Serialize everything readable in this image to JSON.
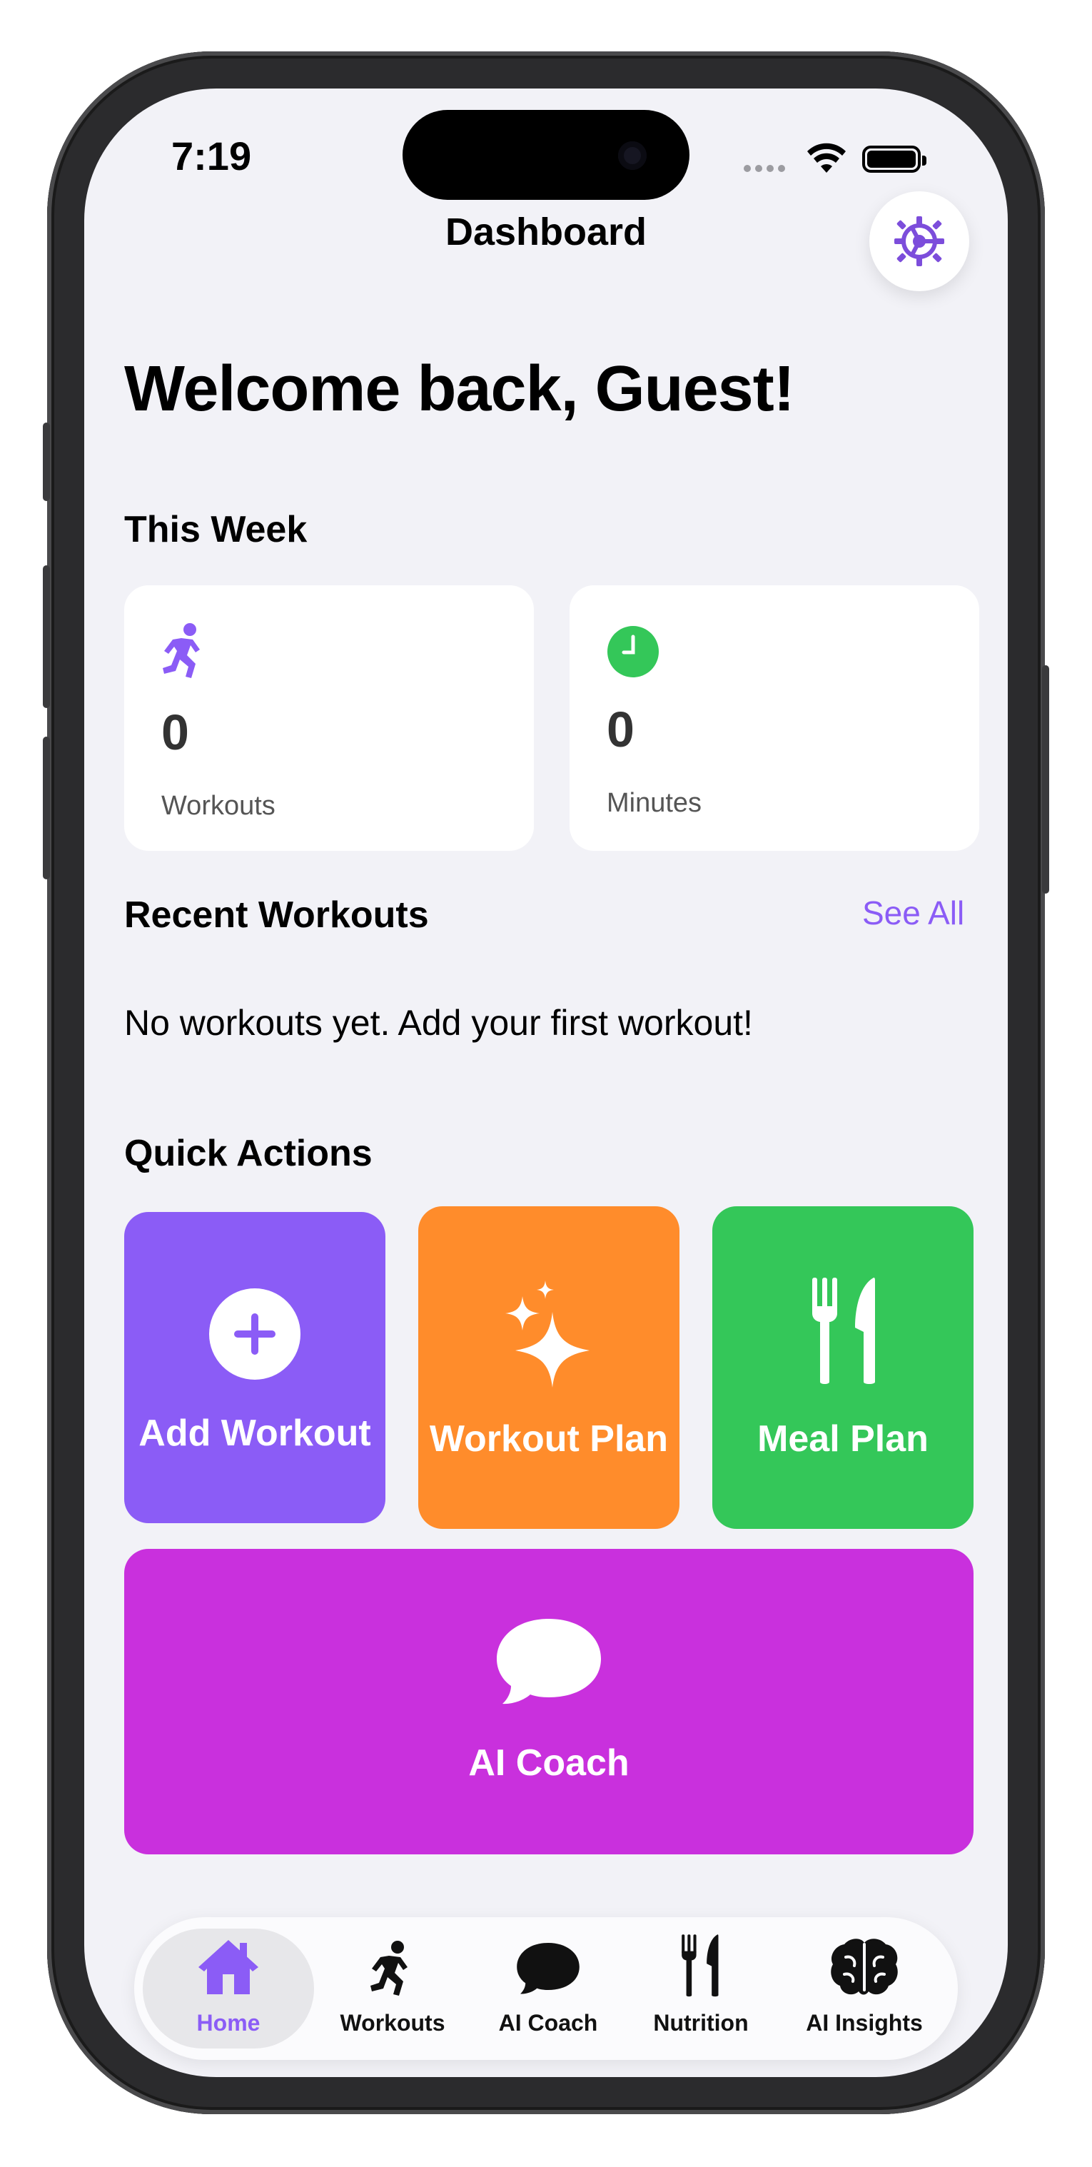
{
  "status_bar": {
    "time": "7:19"
  },
  "nav": {
    "title": "Dashboard"
  },
  "welcome": "Welcome back, Guest!",
  "this_week": {
    "heading": "This Week",
    "stats": [
      {
        "icon": "running-figure-icon",
        "value": "0",
        "label": "Workouts",
        "color": "#8b5cf6"
      },
      {
        "icon": "clock-icon",
        "value": "0",
        "label": "Minutes",
        "color": "#34c759"
      }
    ]
  },
  "recent": {
    "heading": "Recent Workouts",
    "see_all": "See All",
    "empty_text": "No workouts yet. Add your first workout!"
  },
  "quick_actions": {
    "heading": "Quick Actions",
    "items": [
      {
        "label": "Add Workout",
        "icon": "plus-circle-icon",
        "color": "#8b5cf6"
      },
      {
        "label": "Workout Plan",
        "icon": "sparkles-icon",
        "color": "#ff8c2b"
      },
      {
        "label": "Meal Plan",
        "icon": "fork-knife-icon",
        "color": "#34c759"
      },
      {
        "label": "AI Coach",
        "icon": "chat-bubble-icon",
        "color": "#c930dd"
      }
    ]
  },
  "tab_bar": {
    "active_color": "#8b5cf6",
    "tabs": [
      {
        "label": "Home",
        "icon": "house-icon",
        "active": true
      },
      {
        "label": "Workouts",
        "icon": "running-figure-icon",
        "active": false
      },
      {
        "label": "AI Coach",
        "icon": "chat-bubble-icon",
        "active": false
      },
      {
        "label": "Nutrition",
        "icon": "fork-knife-icon",
        "active": false
      },
      {
        "label": "AI Insights",
        "icon": "brain-icon",
        "active": false
      }
    ]
  }
}
